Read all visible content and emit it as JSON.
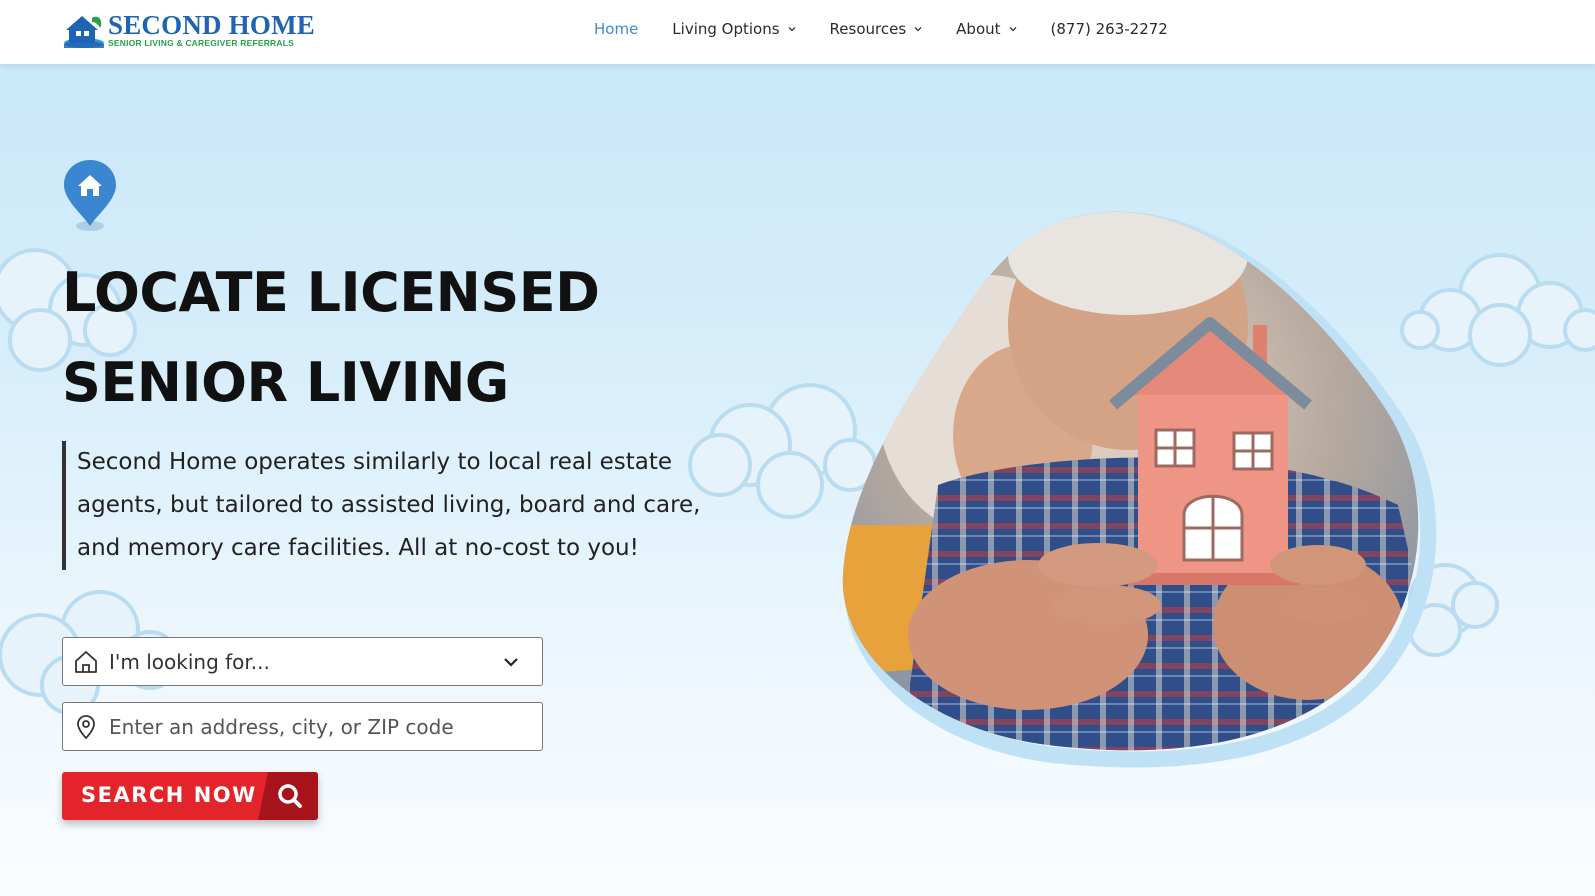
{
  "brand": {
    "name": "SECOND HOME",
    "tagline": "SENIOR LIVING & CAREGIVER REFERRALS"
  },
  "nav": {
    "items": [
      {
        "label": "Home",
        "active": true
      },
      {
        "label": "Living Options",
        "has_dropdown": true
      },
      {
        "label": "Resources",
        "has_dropdown": true
      },
      {
        "label": "About",
        "has_dropdown": true
      },
      {
        "label": "(877) 263-2272"
      }
    ]
  },
  "hero": {
    "headline_line1": "LOCATE LICENSED",
    "headline_line2": "SENIOR LIVING",
    "description": "Second Home operates similarly to local real estate agents, but tailored to assisted living, board and care, and memory care facilities. All at no-cost to you!",
    "select_placeholder": "I'm looking for...",
    "address_placeholder": "Enter an address, city, or ZIP code",
    "search_label": "SEARCH NOW"
  },
  "icons": {
    "pin": "home-pin-icon",
    "select": "house-outline-icon",
    "address": "location-pin-icon",
    "dropdown": "chevron-down-icon",
    "search": "search-icon"
  },
  "colors": {
    "accent_blue": "#3a8ed0",
    "button_red": "#e3242b",
    "logo_blue": "#1e63b4",
    "logo_green": "#27a24a"
  }
}
